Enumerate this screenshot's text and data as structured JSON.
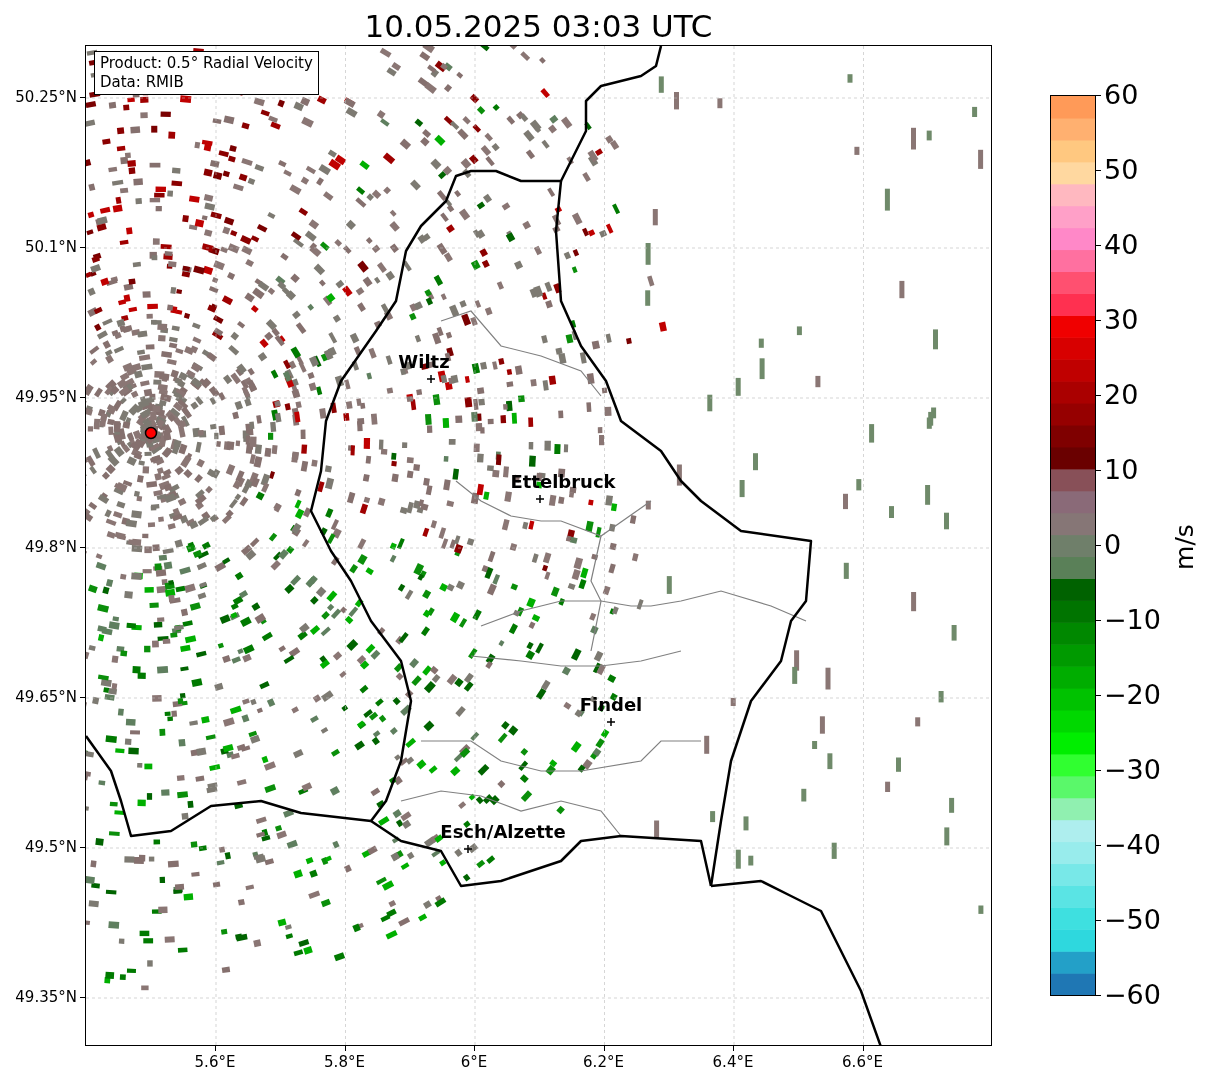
{
  "title": "10.05.2025 03:03 UTC",
  "legend": [
    "Product: 0.5° Radial Velocity",
    "Data: RMIB"
  ],
  "lat_ticks": [
    "50.25°N",
    "50.1°N",
    "49.95°N",
    "49.8°N",
    "49.65°N",
    "49.5°N",
    "49.35°N"
  ],
  "lon_ticks": [
    "5.6°E",
    "5.8°E",
    "6°E",
    "6.2°E",
    "6.4°E",
    "6.6°E"
  ],
  "cities": [
    "Wiltz",
    "Ettelbruck",
    "Findel",
    "Esch/Alzette"
  ],
  "colorbar": {
    "ticks": [
      "60",
      "50",
      "40",
      "30",
      "20",
      "10",
      "0",
      "−10",
      "−20",
      "−30",
      "−40",
      "−50",
      "−60"
    ],
    "label": "m/s"
  }
}
